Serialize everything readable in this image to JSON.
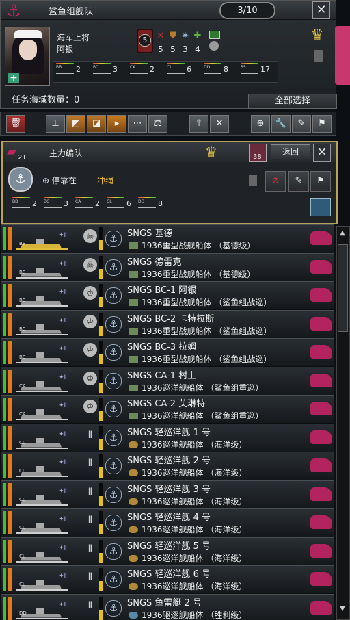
{
  "fleet": {
    "title": "鲨鱼组舰队",
    "page_counter": "3/10",
    "rank": "海军上将",
    "commander": "阿银",
    "skill_level": "5",
    "traits": [
      {
        "icon": "crossed-swords-icon",
        "value": "5",
        "color": "#c03030"
      },
      {
        "icon": "shield-icon",
        "value": "5",
        "color": "#b87a2a"
      },
      {
        "icon": "gear-icon",
        "value": "3",
        "color": "#8fb2d4"
      },
      {
        "icon": "plus-cross-icon",
        "value": "4",
        "color": "#5fae45"
      }
    ],
    "ship_counts": [
      {
        "type": "BB",
        "count": "2"
      },
      {
        "type": "BC",
        "count": "3"
      },
      {
        "type": "CA",
        "count": "2"
      },
      {
        "type": "CL",
        "count": "6"
      },
      {
        "type": "DD",
        "count": "8"
      },
      {
        "type": "SS",
        "count": "17"
      }
    ],
    "mission_label": "任务海域数量：0",
    "select_all": "全部选择"
  },
  "close_glyph": "✕",
  "group": {
    "number": "21",
    "title": "主力编队",
    "number2": "38",
    "back_label": "返回",
    "docked_label": "停靠在",
    "docked_location": "冲绳",
    "ship_counts": [
      {
        "type": "BB",
        "count": "2"
      },
      {
        "type": "BC",
        "count": "3"
      },
      {
        "type": "CA",
        "count": "2"
      },
      {
        "type": "CL",
        "count": "6"
      },
      {
        "type": "DD",
        "count": "8"
      }
    ]
  },
  "ships": [
    {
      "name": "SNGS 基德",
      "type": "1936重型战舰船体 （基德级）",
      "class": "BB",
      "emblem": "skull",
      "hull_icon": "bb",
      "gold": true
    },
    {
      "name": "SNGS 德雷克",
      "type": "1936重型战舰船体 （基德级）",
      "class": "BB",
      "emblem": "skull",
      "hull_icon": "bb",
      "gold": false
    },
    {
      "name": "SNGS BC-1 阿银",
      "type": "1936重型战舰船体 （鲨鱼组战巡）",
      "class": "BC",
      "emblem": "wreath",
      "hull_icon": "bb",
      "gold": false
    },
    {
      "name": "SNGS BC-2 卡特拉斯",
      "type": "1936重型战舰船体 （鲨鱼组战巡）",
      "class": "BC",
      "emblem": "wreath",
      "hull_icon": "bb",
      "gold": false
    },
    {
      "name": "SNGS BC-3 拉姆",
      "type": "1936重型战舰船体 （鲨鱼组战巡）",
      "class": "BC",
      "emblem": "wreath",
      "hull_icon": "bb",
      "gold": false
    },
    {
      "name": "SNGS CA-1 村上",
      "type": "1936巡洋舰船体 （鲨鱼组重巡）",
      "class": "CA",
      "emblem": "wreath",
      "hull_icon": "bb",
      "gold": false
    },
    {
      "name": "SNGS CA-2 芙琳特",
      "type": "1936巡洋舰船体 （鲨鱼组重巡）",
      "class": "CA",
      "emblem": "wreath",
      "hull_icon": "bb",
      "gold": false
    },
    {
      "name": "SNGS 轻巡洋舰 1 号",
      "type": "1936巡洋舰船体 （海洋级）",
      "class": "CL",
      "emblem": "plain",
      "hull_icon": "cl",
      "gold": false
    },
    {
      "name": "SNGS 轻巡洋舰 2 号",
      "type": "1936巡洋舰船体 （海洋级）",
      "class": "CL",
      "emblem": "plain",
      "hull_icon": "cl",
      "gold": false
    },
    {
      "name": "SNGS 轻巡洋舰 3 号",
      "type": "1936巡洋舰船体 （海洋级）",
      "class": "CL",
      "emblem": "plain",
      "hull_icon": "cl",
      "gold": false
    },
    {
      "name": "SNGS 轻巡洋舰 4 号",
      "type": "1936巡洋舰船体 （海洋级）",
      "class": "CL",
      "emblem": "plain",
      "hull_icon": "cl",
      "gold": false
    },
    {
      "name": "SNGS 轻巡洋舰 5 号",
      "type": "1936巡洋舰船体 （海洋级）",
      "class": "CL",
      "emblem": "plain",
      "hull_icon": "cl",
      "gold": false
    },
    {
      "name": "SNGS 轻巡洋舰 6 号",
      "type": "1936巡洋舰船体 （海洋级）",
      "class": "CL",
      "emblem": "plain",
      "hull_icon": "cl",
      "gold": false
    },
    {
      "name": "SNGS 鱼雷艇 2 号",
      "type": "1936驱逐舰船体 （胜利级）",
      "class": "DD",
      "emblem": "plain",
      "hull_icon": "dd",
      "gold": false
    }
  ],
  "colors": {
    "accent_magenta": "#c8376e",
    "gold_border": "#b8a15a",
    "location_yellow": "#f0c030"
  }
}
